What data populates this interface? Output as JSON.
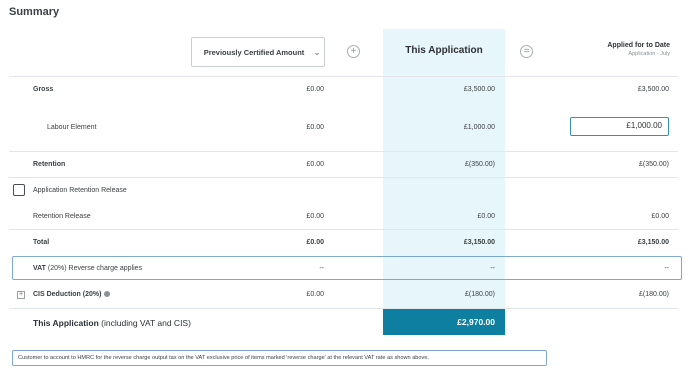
{
  "summary": {
    "title": "Summary"
  },
  "header": {
    "previous_select_label": "Previously Certified Amount",
    "plus_icon": "plus-circle-icon",
    "equals_icon": "equals-circle-icon",
    "this_application_label": "This Application",
    "applied_label": "Applied for to Date",
    "applied_sub": "Application - July"
  },
  "rows": {
    "gross": {
      "label": "Gross",
      "previous": "£0.00",
      "current": "£3,500.00",
      "applied": "£3,500.00"
    },
    "labour": {
      "label": "Labour Element",
      "previous": "£0.00",
      "current": "£1,000.00",
      "applied_input": "£1,000.00"
    },
    "retention": {
      "label": "Retention",
      "previous": "£0.00",
      "current": "£(350.00)",
      "applied": "£(350.00)"
    },
    "app_retention_release": {
      "label": "Application Retention Release",
      "checked": false
    },
    "retention_release": {
      "label": "Retention Release",
      "previous": "£0.00",
      "current": "£0.00",
      "applied": "£0.00"
    },
    "total": {
      "label": "Total",
      "previous": "£0.00",
      "current": "£3,150.00",
      "applied": "£3,150.00"
    },
    "vat": {
      "label_bold": "VAT",
      "label_rest": "(20%) Reverse charge applies",
      "previous": "--",
      "current": "--",
      "applied": "--"
    },
    "cis": {
      "label": "CIS Deduction (20%)",
      "previous": "£0.00",
      "current": "£(180.00)",
      "applied": "£(180.00)"
    }
  },
  "footer": {
    "total_label_bold": "This Application",
    "total_label_rest": "(including VAT and CIS)",
    "total_value": "£2,970.00",
    "note": "Customer to account to HMRC for the reverse charge output tax on the VAT exclusive price of items marked 'reverse charge' at the relevant VAT rate as shown above."
  },
  "colors": {
    "accent": "#0e7fa1",
    "highlight": "#e6f6fb",
    "outline": "#7fa8cf"
  }
}
